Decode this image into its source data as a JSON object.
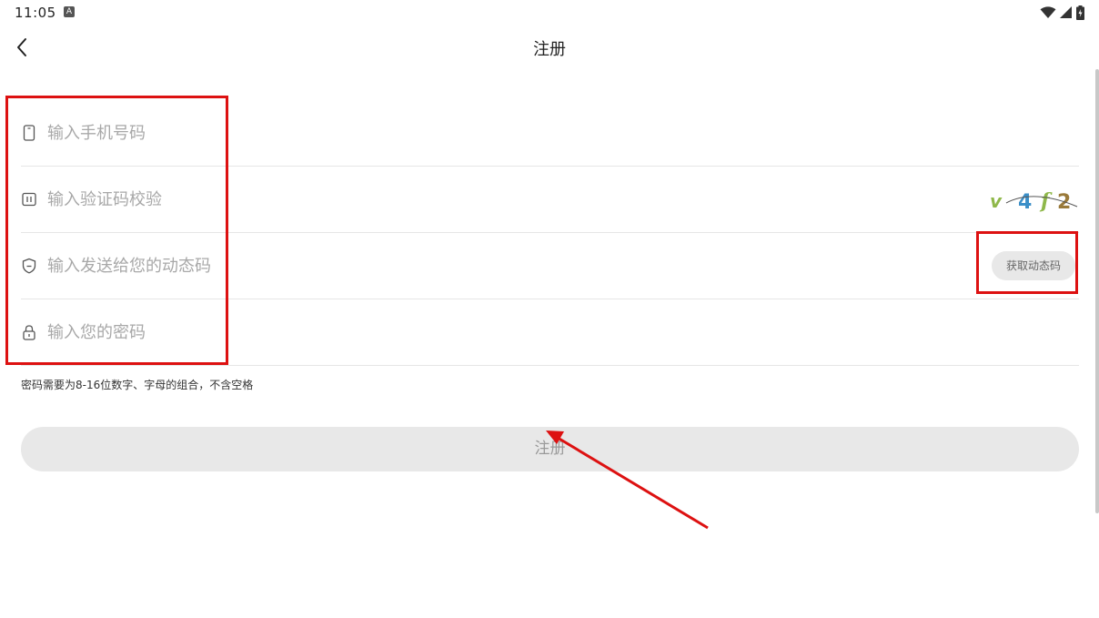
{
  "status_bar": {
    "time": "11:05",
    "notification_icon": "a-badge-icon",
    "icons": [
      "wifi-icon",
      "signal-icon",
      "battery-icon"
    ]
  },
  "app_bar": {
    "back_icon": "chevron-left-icon",
    "title": "注册"
  },
  "form": {
    "phone": {
      "icon": "phone-icon",
      "placeholder": "输入手机号码",
      "value": ""
    },
    "captcha_check": {
      "icon": "captcha-icon",
      "placeholder": "输入验证码校验",
      "value": "",
      "captcha": "v4f2"
    },
    "dynamic_code": {
      "icon": "shield-icon",
      "placeholder": "输入发送给您的动态码",
      "value": "",
      "button_label": "获取动态码"
    },
    "password": {
      "icon": "lock-icon",
      "placeholder": "输入您的密码",
      "value": ""
    }
  },
  "hint": "密码需要为8-16位数字、字母的组合，不含空格",
  "register_button": {
    "label": "注册",
    "enabled": false
  },
  "colors": {
    "annotation": "#dd1111",
    "button_bg": "#e8e8e8",
    "placeholder": "#a8a8a8"
  }
}
